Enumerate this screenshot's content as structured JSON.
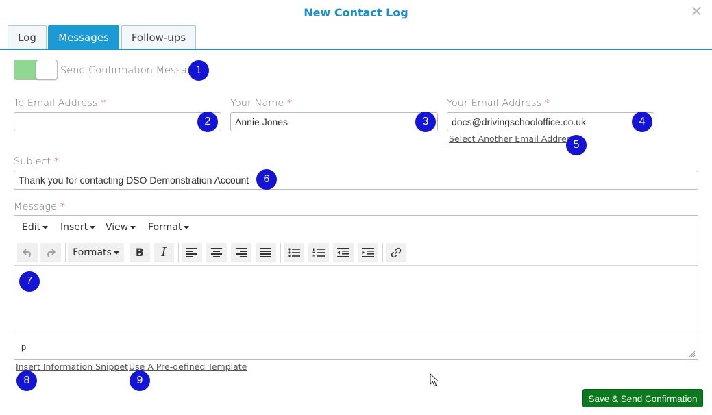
{
  "modal": {
    "title": "New Contact Log",
    "close_glyph": "✕"
  },
  "tabs": [
    {
      "label": "Log",
      "active": false
    },
    {
      "label": "Messages",
      "active": true
    },
    {
      "label": "Follow-ups",
      "active": false
    }
  ],
  "confirmation": {
    "label": "Send Confirmation Message",
    "enabled": true,
    "accent": "#8ed892"
  },
  "fields": {
    "to_email": {
      "label": "To Email Address",
      "required_mark": "*",
      "value": ""
    },
    "your_name": {
      "label": "Your Name",
      "required_mark": "*",
      "value": "Annie Jones"
    },
    "your_email": {
      "label": "Your Email Address",
      "required_mark": "*",
      "value": "docs@drivingschooloffice.co.uk"
    },
    "select_another_email": "Select Another Email Address",
    "subject": {
      "label": "Subject",
      "required_mark": "*",
      "value": "Thank you for contacting DSO Demonstration Account"
    },
    "message": {
      "label": "Message",
      "required_mark": "*"
    }
  },
  "editor": {
    "menus": [
      "Edit",
      "Insert",
      "View",
      "Format"
    ],
    "formats_label": "Formats",
    "bold": "B",
    "italic": "I",
    "path": "p"
  },
  "links": {
    "insert_snippet": "Insert Information Snippet",
    "use_template": "Use A Pre-defined Template"
  },
  "markers": [
    "1",
    "2",
    "3",
    "4",
    "5",
    "6",
    "7",
    "8",
    "9"
  ],
  "save_button": {
    "label": "Save & Send Confirmation",
    "color": "#0b7a1e"
  }
}
